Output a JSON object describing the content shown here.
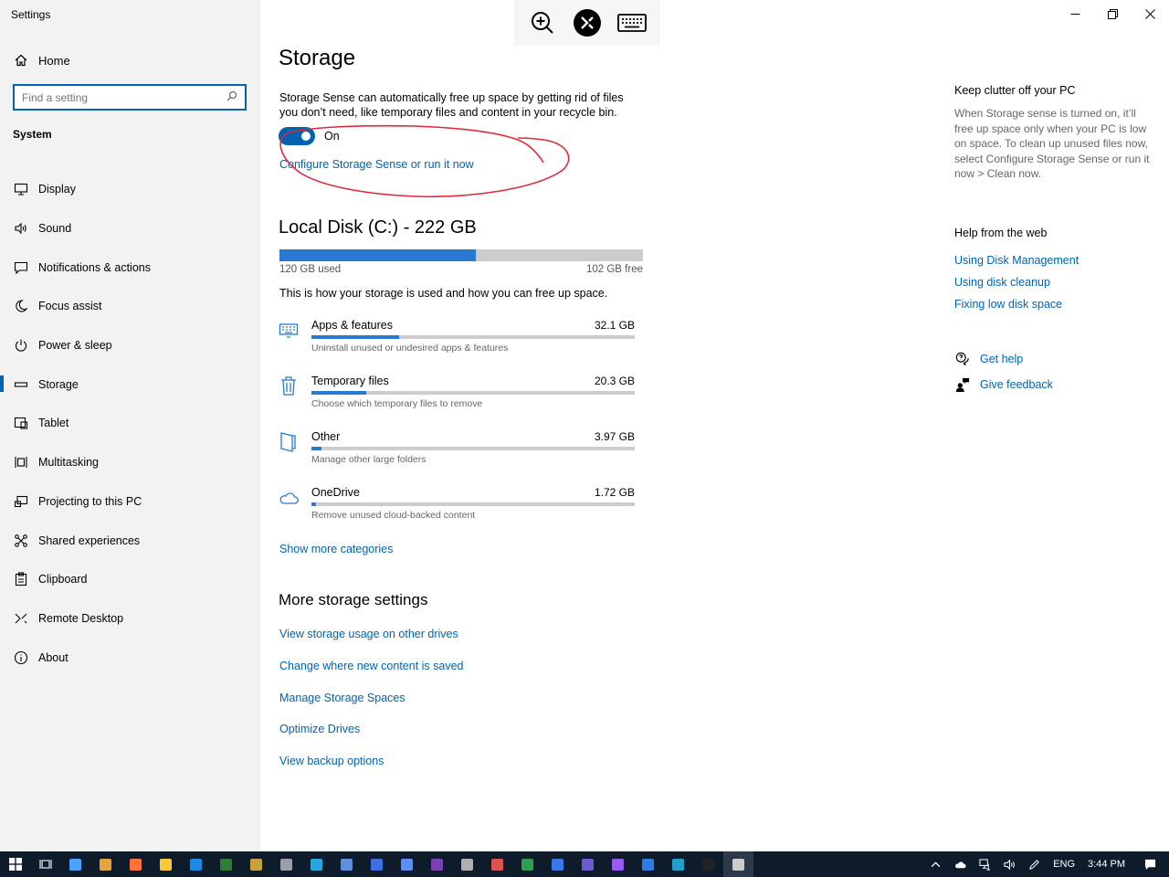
{
  "window": {
    "title": "Settings"
  },
  "sidebar": {
    "home_label": "Home",
    "search_placeholder": "Find a setting",
    "section": "System",
    "items": [
      {
        "label": "Display",
        "icon": "monitor-icon"
      },
      {
        "label": "Sound",
        "icon": "speaker-icon"
      },
      {
        "label": "Notifications & actions",
        "icon": "notification-icon"
      },
      {
        "label": "Focus assist",
        "icon": "moon-icon"
      },
      {
        "label": "Power & sleep",
        "icon": "power-icon"
      },
      {
        "label": "Storage",
        "icon": "storage-icon",
        "active": true
      },
      {
        "label": "Tablet",
        "icon": "tablet-icon"
      },
      {
        "label": "Multitasking",
        "icon": "multitasking-icon"
      },
      {
        "label": "Projecting to this PC",
        "icon": "projecting-icon"
      },
      {
        "label": "Shared experiences",
        "icon": "shared-icon"
      },
      {
        "label": "Clipboard",
        "icon": "clipboard-icon"
      },
      {
        "label": "Remote Desktop",
        "icon": "remote-desktop-icon"
      },
      {
        "label": "About",
        "icon": "info-icon"
      }
    ]
  },
  "main": {
    "title": "Storage",
    "sense_description": "Storage Sense can automatically free up space by getting rid of files you don’t need, like temporary files and content in your recycle bin.",
    "toggle_label": "On",
    "configure_link": "Configure Storage Sense or run it now",
    "disk": {
      "title": "Local Disk (C:) - 222 GB",
      "used_label": "120 GB used",
      "free_label": "102 GB free",
      "used_fraction": 0.54
    },
    "usage_description": "This is how your storage is used and how you can free up space.",
    "categories": [
      {
        "name": "Apps & features",
        "size": "32.1 GB",
        "sub": "Uninstall unused or undesired apps & features",
        "fraction": 0.27,
        "icon": "apps-icon"
      },
      {
        "name": "Temporary files",
        "size": "20.3 GB",
        "sub": "Choose which temporary files to remove",
        "fraction": 0.17,
        "icon": "trash-icon"
      },
      {
        "name": "Other",
        "size": "3.97 GB",
        "sub": "Manage other large folders",
        "fraction": 0.03,
        "icon": "folder-icon"
      },
      {
        "name": "OneDrive",
        "size": "1.72 GB",
        "sub": "Remove unused cloud-backed content",
        "fraction": 0.015,
        "icon": "cloud-icon"
      }
    ],
    "show_more": "Show more categories",
    "more_title": "More storage settings",
    "more_links": [
      "View storage usage on other drives",
      "Change where new content is saved",
      "Manage Storage Spaces",
      "Optimize Drives",
      "View backup options"
    ]
  },
  "right": {
    "clutter_title": "Keep clutter off your PC",
    "clutter_text": "When Storage sense is turned on, it’ll free up space only when your PC is low on space. To clean up unused files now, select Configure Storage Sense or run it now > Clean now.",
    "web_title": "Help from the web",
    "web_links": [
      "Using Disk Management",
      "Using disk cleanup",
      "Fixing low disk space"
    ],
    "get_help": "Get help",
    "give_feedback": "Give feedback"
  },
  "taskbar": {
    "language": "ENG",
    "time": "3:44 PM",
    "app_colors": [
      "#4aa3ff",
      "#e8a33d",
      "#ff7139",
      "#f7c93b",
      "#1e88e5",
      "#2e7d32",
      "#c7a13c",
      "#9aa0a6",
      "#2aa6df",
      "#5c8fe0",
      "#3d6fe0",
      "#5b8ff9",
      "#7b3fb3",
      "#b0b0b0",
      "#d9534f",
      "#2e9e4f",
      "#3b78e7",
      "#6d5acf",
      "#9b59f5",
      "#2d7be5",
      "#1fa1c9",
      "#222222",
      "#cccccc"
    ]
  }
}
